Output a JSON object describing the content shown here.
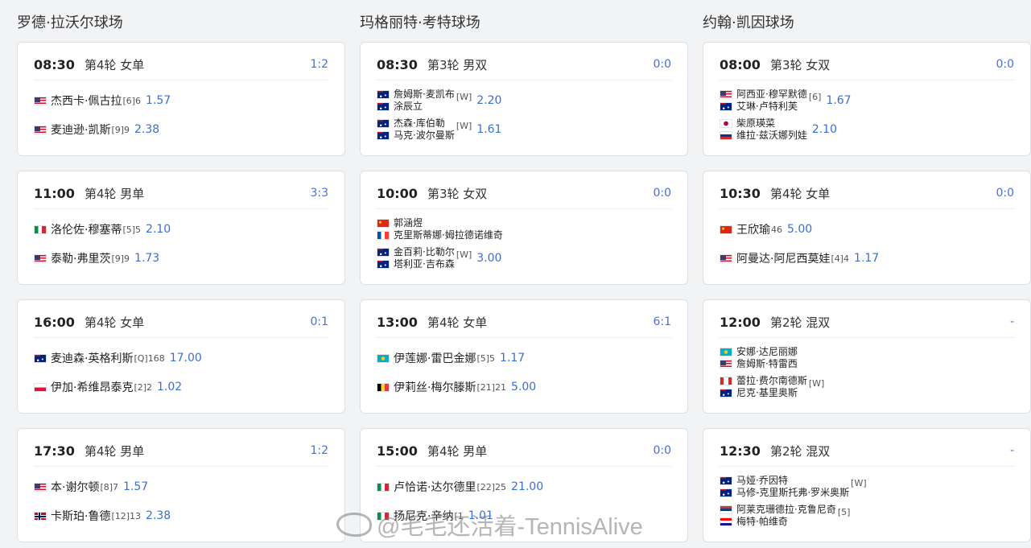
{
  "courts": [
    {
      "name": "罗德·拉沃尔球场",
      "matches": [
        {
          "time": "08:30",
          "round": "第4轮 女单",
          "score": "1:2",
          "sides": [
            {
              "players": [
                {
                  "flag": "us",
                  "name": "杰西卡·佩古拉"
                }
              ],
              "seed": "[6]6",
              "odds": "1.57"
            },
            {
              "players": [
                {
                  "flag": "us",
                  "name": "麦迪逊·凯斯"
                }
              ],
              "seed": "[9]9",
              "odds": "2.38"
            }
          ]
        },
        {
          "time": "11:00",
          "round": "第4轮 男单",
          "score": "3:3",
          "sides": [
            {
              "players": [
                {
                  "flag": "it",
                  "name": "洛伦佐·穆塞蒂"
                }
              ],
              "seed": "[5]5",
              "odds": "2.10"
            },
            {
              "players": [
                {
                  "flag": "us",
                  "name": "泰勒·弗里茨"
                }
              ],
              "seed": "[9]9",
              "odds": "1.73"
            }
          ]
        },
        {
          "time": "16:00",
          "round": "第4轮 女单",
          "score": "0:1",
          "sides": [
            {
              "players": [
                {
                  "flag": "au",
                  "name": "麦迪森·英格利斯"
                }
              ],
              "seed": "[Q]168",
              "odds": "17.00"
            },
            {
              "players": [
                {
                  "flag": "pl",
                  "name": "伊加·希维昂泰克"
                }
              ],
              "seed": "[2]2",
              "odds": "1.02"
            }
          ]
        },
        {
          "time": "17:30",
          "round": "第4轮 男单",
          "score": "1:2",
          "sides": [
            {
              "players": [
                {
                  "flag": "us",
                  "name": "本·谢尔顿"
                }
              ],
              "seed": "[8]7",
              "odds": "1.57"
            },
            {
              "players": [
                {
                  "flag": "no",
                  "name": "卡斯珀·鲁德"
                }
              ],
              "seed": "[12]13",
              "odds": "2.38"
            }
          ]
        }
      ]
    },
    {
      "name": "玛格丽特·考特球场",
      "matches": [
        {
          "time": "08:30",
          "round": "第3轮 男双",
          "score": "0:0",
          "sides": [
            {
              "players": [
                {
                  "flag": "au",
                  "name": "詹姆斯·麦凯布"
                },
                {
                  "flag": "au",
                  "name": "涂辰立"
                }
              ],
              "seed": "[W]",
              "odds": "2.20"
            },
            {
              "players": [
                {
                  "flag": "au",
                  "name": "杰森·库伯勒"
                },
                {
                  "flag": "au",
                  "name": "马克·波尔曼斯"
                }
              ],
              "seed": "[W]",
              "odds": "1.61"
            }
          ]
        },
        {
          "time": "10:00",
          "round": "第3轮 女双",
          "score": "0:0",
          "sides": [
            {
              "players": [
                {
                  "flag": "cn",
                  "name": "郭涵煜"
                },
                {
                  "flag": "fr",
                  "name": "克里斯蒂娜·姆拉德诺维奇"
                }
              ],
              "seed": "",
              "odds": ""
            },
            {
              "players": [
                {
                  "flag": "au",
                  "name": "金百莉·比勒尔"
                },
                {
                  "flag": "au",
                  "name": "塔利亚·吉布森"
                }
              ],
              "seed": "[W]",
              "odds": "3.00"
            }
          ]
        },
        {
          "time": "13:00",
          "round": "第4轮 女单",
          "score": "6:1",
          "sides": [
            {
              "players": [
                {
                  "flag": "kz",
                  "name": "伊莲娜·雷巴金娜"
                }
              ],
              "seed": "[5]5",
              "odds": "1.17"
            },
            {
              "players": [
                {
                  "flag": "be",
                  "name": "伊莉丝·梅尔滕斯"
                }
              ],
              "seed": "[21]21",
              "odds": "5.00"
            }
          ]
        },
        {
          "time": "15:00",
          "round": "第4轮 男单",
          "score": "0:0",
          "sides": [
            {
              "players": [
                {
                  "flag": "it",
                  "name": "卢恰诺·达尔德里"
                }
              ],
              "seed": "[22]25",
              "odds": "21.00"
            },
            {
              "players": [
                {
                  "flag": "it",
                  "name": "扬尼克·辛纳"
                }
              ],
              "seed": "[1",
              "odds": "1.01"
            }
          ]
        }
      ]
    },
    {
      "name": "约翰·凯因球场",
      "matches": [
        {
          "time": "08:00",
          "round": "第3轮 女双",
          "score": "0:0",
          "sides": [
            {
              "players": [
                {
                  "flag": "us",
                  "name": "阿西亚·穆罕默德"
                },
                {
                  "flag": "au",
                  "name": "艾琳·卢特利芙"
                }
              ],
              "seed": "[6]",
              "odds": "1.67"
            },
            {
              "players": [
                {
                  "flag": "jp",
                  "name": "柴原瑛菜"
                },
                {
                  "flag": "ru",
                  "name": "维拉·兹沃娜列娃"
                }
              ],
              "seed": "",
              "odds": "2.10"
            }
          ]
        },
        {
          "time": "10:30",
          "round": "第4轮 女单",
          "score": "0:0",
          "sides": [
            {
              "players": [
                {
                  "flag": "cn",
                  "name": "王欣瑜"
                }
              ],
              "seed": "46",
              "odds": "5.00"
            },
            {
              "players": [
                {
                  "flag": "us",
                  "name": "阿曼达·阿尼西莫娃"
                }
              ],
              "seed": "[4]4",
              "odds": "1.17"
            }
          ]
        },
        {
          "time": "12:00",
          "round": "第2轮 混双",
          "score": "-",
          "sides": [
            {
              "players": [
                {
                  "flag": "kz",
                  "name": "安娜·达尼丽娜"
                },
                {
                  "flag": "us",
                  "name": "詹姆斯·特雷西"
                }
              ],
              "seed": "",
              "odds": ""
            },
            {
              "players": [
                {
                  "flag": "ca",
                  "name": "蕾拉·费尔南德斯"
                },
                {
                  "flag": "au",
                  "name": "尼克·基里奥斯"
                }
              ],
              "seed": "[W]",
              "odds": ""
            }
          ]
        },
        {
          "time": "12:30",
          "round": "第2轮 混双",
          "score": "-",
          "sides": [
            {
              "players": [
                {
                  "flag": "au",
                  "name": "马娅·乔因特"
                },
                {
                  "flag": "au",
                  "name": "马修-克里斯托弗·罗米奥斯"
                }
              ],
              "seed": "[W]",
              "odds": ""
            },
            {
              "players": [
                {
                  "flag": "rs",
                  "name": "阿莱克珊德拉·克鲁尼奇"
                },
                {
                  "flag": "hr",
                  "name": "梅特·帕维奇"
                }
              ],
              "seed": "[5]",
              "odds": ""
            }
          ]
        }
      ]
    }
  ],
  "watermark": "@毛毛还活着-TennisAlive"
}
